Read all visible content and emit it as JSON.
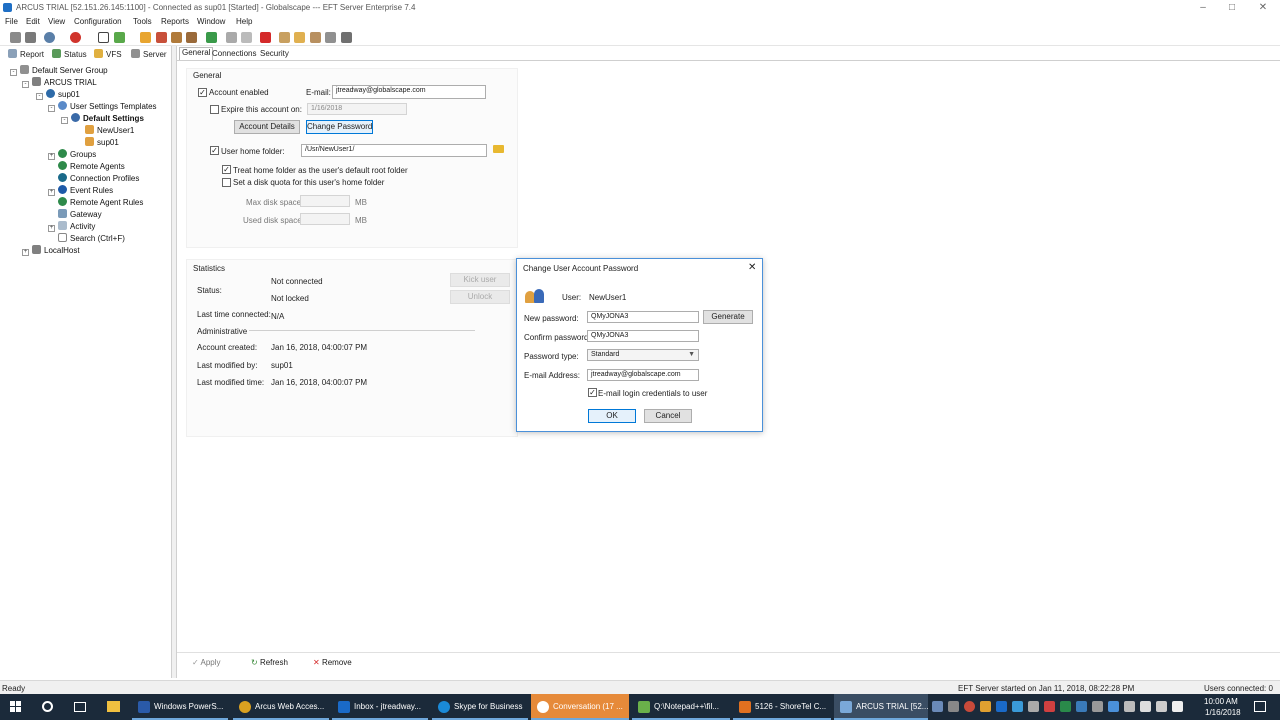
{
  "window": {
    "title": "ARCUS TRIAL [52.151.26.145:1100] - Connected as sup01 [Started] - Globalscape --- EFT Server Enterprise 7.4"
  },
  "menu": [
    "File",
    "Edit",
    "View",
    "Configuration",
    "Tools",
    "Reports",
    "Window",
    "Help"
  ],
  "left_tabs": [
    "Report",
    "Status",
    "VFS",
    "Server"
  ],
  "tree": {
    "root": "Default Server Group",
    "server": "ARCUS TRIAL",
    "site": "sup01",
    "templates": "User Settings Templates",
    "default_settings": "Default Settings",
    "user1": "NewUser1",
    "user2": "sup01",
    "items": [
      "Groups",
      "Remote Agents",
      "Connection Profiles",
      "Event Rules",
      "Remote Agent Rules",
      "Gateway",
      "Activity",
      "Search (Ctrl+F)"
    ],
    "localhost": "LocalHost"
  },
  "right_tabs": [
    "General",
    "Connections",
    "Security"
  ],
  "general": {
    "group_title": "General",
    "account_enabled": "Account enabled",
    "email_label": "E-mail:",
    "email_value": "jtreadway@globalscape.com",
    "expire_label": "Expire this account on:",
    "expire_date": "1/16/2018",
    "account_details": "Account Details",
    "change_password": "Change Password",
    "home_folder_label": "User home folder:",
    "home_folder_value": "/Usr/NewUser1/",
    "treat_home": "Treat home folder as the user's default root folder",
    "disk_quota": "Set a disk quota for this user's home folder",
    "max_disk": "Max disk space:",
    "used_disk": "Used disk space:",
    "mb1": "MB",
    "mb2": "MB"
  },
  "statistics": {
    "title": "Statistics",
    "status_label": "Status:",
    "not_connected": "Not connected",
    "not_locked": "Not locked",
    "kick_user": "Kick user",
    "unlock": "Unlock",
    "last_connected_label": "Last time connected:",
    "last_connected_value": "N/A",
    "administrative": "Administrative",
    "account_created_label": "Account created:",
    "account_created_value": "Jan 16, 2018, 04:00:07 PM",
    "last_modified_by_label": "Last modified by:",
    "last_modified_by_value": "sup01",
    "last_modified_time_label": "Last modified time:",
    "last_modified_time_value": "Jan 16, 2018, 04:00:07 PM"
  },
  "actions": {
    "apply": "Apply",
    "refresh": "Refresh",
    "remove": "Remove"
  },
  "dialog": {
    "title": "Change User Account Password",
    "user_label": "User:",
    "user_value": "NewUser1",
    "new_password_label": "New password:",
    "new_password_value": "QMyJONA3",
    "generate": "Generate",
    "confirm_label": "Confirm password:",
    "confirm_value": "QMyJONA3",
    "type_label": "Password type:",
    "type_value": "Standard",
    "email_label": "E-mail Address:",
    "email_value": "jtreadway@globalscape.com",
    "email_creds": "E-mail login credentials to user",
    "ok": "OK",
    "cancel": "Cancel"
  },
  "statusbar": {
    "left": "Ready",
    "middle": "EFT Server started on Jan 11, 2018, 08:22:28 PM",
    "right": "Users connected: 0"
  },
  "taskbar": {
    "items": [
      "Windows PowerS...",
      "Arcus Web Acces...",
      "Inbox - jtreadway...",
      "Skype for Business",
      "Conversation (17 ...",
      "Q:\\Notepad++\\fil...",
      "5126 - ShoreTel C...",
      "ARCUS TRIAL [52..."
    ],
    "time": "10:00 AM",
    "date": "1/16/2018"
  },
  "colors": {
    "accent": "#0078d7",
    "taskbar": "#1b2a3a",
    "highlight_task": "#e68a3a"
  }
}
